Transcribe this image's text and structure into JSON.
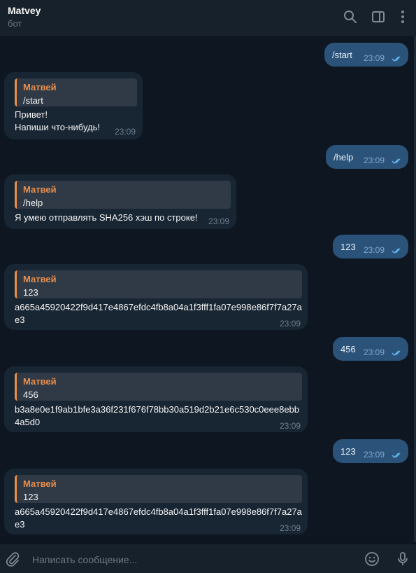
{
  "header": {
    "title": "Matvey",
    "subtitle": "бот",
    "icons": [
      "search-icon",
      "sidebar-toggle-icon",
      "more-vertical-icon"
    ]
  },
  "messages": [
    {
      "dir": "out",
      "text": "/start",
      "time": "23:09"
    },
    {
      "dir": "in",
      "quote_name": "Матвей",
      "quote_text": "/start",
      "text": "Привет!\nНапиши что-нибудь!",
      "time": "23:09"
    },
    {
      "dir": "out",
      "text": "/help",
      "time": "23:09"
    },
    {
      "dir": "in",
      "quote_name": "Матвей",
      "quote_text": "/help",
      "text": "Я умею отправлять SHA256 хэш по строке!",
      "time": "23:09"
    },
    {
      "dir": "out",
      "text": "123",
      "time": "23:09"
    },
    {
      "dir": "in",
      "quote_name": "Матвей",
      "quote_text": "123",
      "text": "a665a45920422f9d417e4867efdc4fb8a04a1f3fff1fa07e998e86f7f7a27ae3",
      "time": "23:09"
    },
    {
      "dir": "out",
      "text": "456",
      "time": "23:09"
    },
    {
      "dir": "in",
      "quote_name": "Матвей",
      "quote_text": "456",
      "text": "b3a8e0e1f9ab1bfe3a36f231f676f78bb30a519d2b21e6c530c0eee8ebb4a5d0",
      "time": "23:09"
    },
    {
      "dir": "out",
      "text": "123",
      "time": "23:09"
    },
    {
      "dir": "in",
      "quote_name": "Матвей",
      "quote_text": "123",
      "text": "a665a45920422f9d417e4867efdc4fb8a04a1f3fff1fa07e998e86f7f7a27ae3",
      "time": "23:09"
    }
  ],
  "composer": {
    "placeholder": "Написать сообщение...",
    "icons": [
      "attach-icon",
      "emoji-icon",
      "microphone-icon"
    ]
  },
  "colors": {
    "background": "#0e1621",
    "header": "#17212b",
    "outgoing_bubble": "#2b5278",
    "incoming_bubble": "#182533",
    "quote_accent": "#e98d4a",
    "read_checks": "#64b5ef"
  }
}
